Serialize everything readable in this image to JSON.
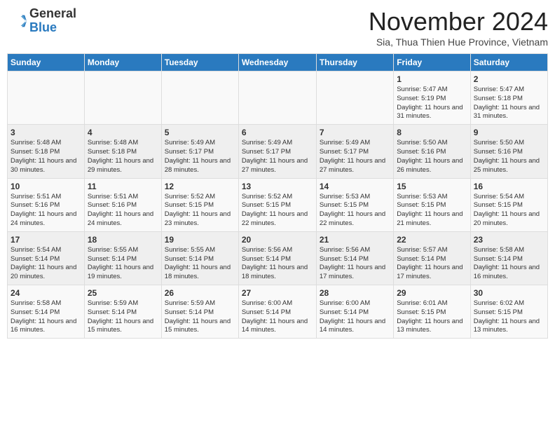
{
  "header": {
    "logo_general": "General",
    "logo_blue": "Blue",
    "month_title": "November 2024",
    "location": "Sia, Thua Thien Hue Province, Vietnam"
  },
  "days_of_week": [
    "Sunday",
    "Monday",
    "Tuesday",
    "Wednesday",
    "Thursday",
    "Friday",
    "Saturday"
  ],
  "weeks": [
    [
      {
        "day": "",
        "info": ""
      },
      {
        "day": "",
        "info": ""
      },
      {
        "day": "",
        "info": ""
      },
      {
        "day": "",
        "info": ""
      },
      {
        "day": "",
        "info": ""
      },
      {
        "day": "1",
        "info": "Sunrise: 5:47 AM\nSunset: 5:19 PM\nDaylight: 11 hours and 31 minutes."
      },
      {
        "day": "2",
        "info": "Sunrise: 5:47 AM\nSunset: 5:18 PM\nDaylight: 11 hours and 31 minutes."
      }
    ],
    [
      {
        "day": "3",
        "info": "Sunrise: 5:48 AM\nSunset: 5:18 PM\nDaylight: 11 hours and 30 minutes."
      },
      {
        "day": "4",
        "info": "Sunrise: 5:48 AM\nSunset: 5:18 PM\nDaylight: 11 hours and 29 minutes."
      },
      {
        "day": "5",
        "info": "Sunrise: 5:49 AM\nSunset: 5:17 PM\nDaylight: 11 hours and 28 minutes."
      },
      {
        "day": "6",
        "info": "Sunrise: 5:49 AM\nSunset: 5:17 PM\nDaylight: 11 hours and 27 minutes."
      },
      {
        "day": "7",
        "info": "Sunrise: 5:49 AM\nSunset: 5:17 PM\nDaylight: 11 hours and 27 minutes."
      },
      {
        "day": "8",
        "info": "Sunrise: 5:50 AM\nSunset: 5:16 PM\nDaylight: 11 hours and 26 minutes."
      },
      {
        "day": "9",
        "info": "Sunrise: 5:50 AM\nSunset: 5:16 PM\nDaylight: 11 hours and 25 minutes."
      }
    ],
    [
      {
        "day": "10",
        "info": "Sunrise: 5:51 AM\nSunset: 5:16 PM\nDaylight: 11 hours and 24 minutes."
      },
      {
        "day": "11",
        "info": "Sunrise: 5:51 AM\nSunset: 5:16 PM\nDaylight: 11 hours and 24 minutes."
      },
      {
        "day": "12",
        "info": "Sunrise: 5:52 AM\nSunset: 5:15 PM\nDaylight: 11 hours and 23 minutes."
      },
      {
        "day": "13",
        "info": "Sunrise: 5:52 AM\nSunset: 5:15 PM\nDaylight: 11 hours and 22 minutes."
      },
      {
        "day": "14",
        "info": "Sunrise: 5:53 AM\nSunset: 5:15 PM\nDaylight: 11 hours and 22 minutes."
      },
      {
        "day": "15",
        "info": "Sunrise: 5:53 AM\nSunset: 5:15 PM\nDaylight: 11 hours and 21 minutes."
      },
      {
        "day": "16",
        "info": "Sunrise: 5:54 AM\nSunset: 5:15 PM\nDaylight: 11 hours and 20 minutes."
      }
    ],
    [
      {
        "day": "17",
        "info": "Sunrise: 5:54 AM\nSunset: 5:14 PM\nDaylight: 11 hours and 20 minutes."
      },
      {
        "day": "18",
        "info": "Sunrise: 5:55 AM\nSunset: 5:14 PM\nDaylight: 11 hours and 19 minutes."
      },
      {
        "day": "19",
        "info": "Sunrise: 5:55 AM\nSunset: 5:14 PM\nDaylight: 11 hours and 18 minutes."
      },
      {
        "day": "20",
        "info": "Sunrise: 5:56 AM\nSunset: 5:14 PM\nDaylight: 11 hours and 18 minutes."
      },
      {
        "day": "21",
        "info": "Sunrise: 5:56 AM\nSunset: 5:14 PM\nDaylight: 11 hours and 17 minutes."
      },
      {
        "day": "22",
        "info": "Sunrise: 5:57 AM\nSunset: 5:14 PM\nDaylight: 11 hours and 17 minutes."
      },
      {
        "day": "23",
        "info": "Sunrise: 5:58 AM\nSunset: 5:14 PM\nDaylight: 11 hours and 16 minutes."
      }
    ],
    [
      {
        "day": "24",
        "info": "Sunrise: 5:58 AM\nSunset: 5:14 PM\nDaylight: 11 hours and 16 minutes."
      },
      {
        "day": "25",
        "info": "Sunrise: 5:59 AM\nSunset: 5:14 PM\nDaylight: 11 hours and 15 minutes."
      },
      {
        "day": "26",
        "info": "Sunrise: 5:59 AM\nSunset: 5:14 PM\nDaylight: 11 hours and 15 minutes."
      },
      {
        "day": "27",
        "info": "Sunrise: 6:00 AM\nSunset: 5:14 PM\nDaylight: 11 hours and 14 minutes."
      },
      {
        "day": "28",
        "info": "Sunrise: 6:00 AM\nSunset: 5:14 PM\nDaylight: 11 hours and 14 minutes."
      },
      {
        "day": "29",
        "info": "Sunrise: 6:01 AM\nSunset: 5:15 PM\nDaylight: 11 hours and 13 minutes."
      },
      {
        "day": "30",
        "info": "Sunrise: 6:02 AM\nSunset: 5:15 PM\nDaylight: 11 hours and 13 minutes."
      }
    ]
  ]
}
